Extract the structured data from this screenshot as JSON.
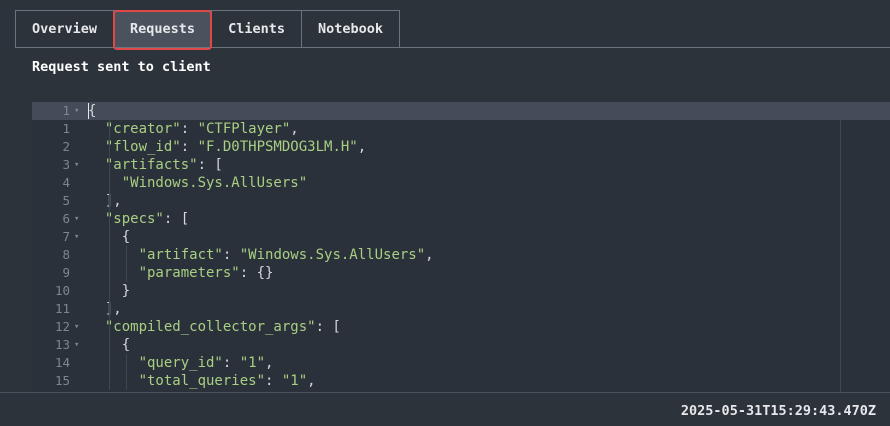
{
  "tabs": [
    {
      "label": "Overview",
      "active": false
    },
    {
      "label": "Requests",
      "active": true
    },
    {
      "label": "Clients",
      "active": false
    },
    {
      "label": "Notebook",
      "active": false
    }
  ],
  "heading": "Request sent to client",
  "editor": {
    "lines": [
      {
        "num": "1",
        "fold": true,
        "text": "{"
      },
      {
        "num": "1",
        "fold": false,
        "text": "  \"creator\": \"CTFPlayer\","
      },
      {
        "num": "2",
        "fold": false,
        "text": "  \"flow_id\": \"F.D0THPSMDOG3LM.H\","
      },
      {
        "num": "3",
        "fold": true,
        "text": "  \"artifacts\": ["
      },
      {
        "num": "4",
        "fold": false,
        "text": "    \"Windows.Sys.AllUsers\""
      },
      {
        "num": "5",
        "fold": false,
        "text": "  ],"
      },
      {
        "num": "6",
        "fold": true,
        "text": "  \"specs\": ["
      },
      {
        "num": "7",
        "fold": true,
        "text": "    {"
      },
      {
        "num": "8",
        "fold": false,
        "text": "      \"artifact\": \"Windows.Sys.AllUsers\","
      },
      {
        "num": "9",
        "fold": false,
        "text": "      \"parameters\": {}"
      },
      {
        "num": "10",
        "fold": false,
        "text": "    }"
      },
      {
        "num": "11",
        "fold": false,
        "text": "  ],"
      },
      {
        "num": "12",
        "fold": true,
        "text": "  \"compiled_collector_args\": ["
      },
      {
        "num": "13",
        "fold": true,
        "text": "    {"
      },
      {
        "num": "14",
        "fold": false,
        "text": "      \"query_id\": \"1\","
      },
      {
        "num": "15",
        "fold": false,
        "text": "      \"total_queries\": \"1\","
      }
    ]
  },
  "footer": {
    "timestamp": "2025-05-31T15:29:43.470Z"
  }
}
